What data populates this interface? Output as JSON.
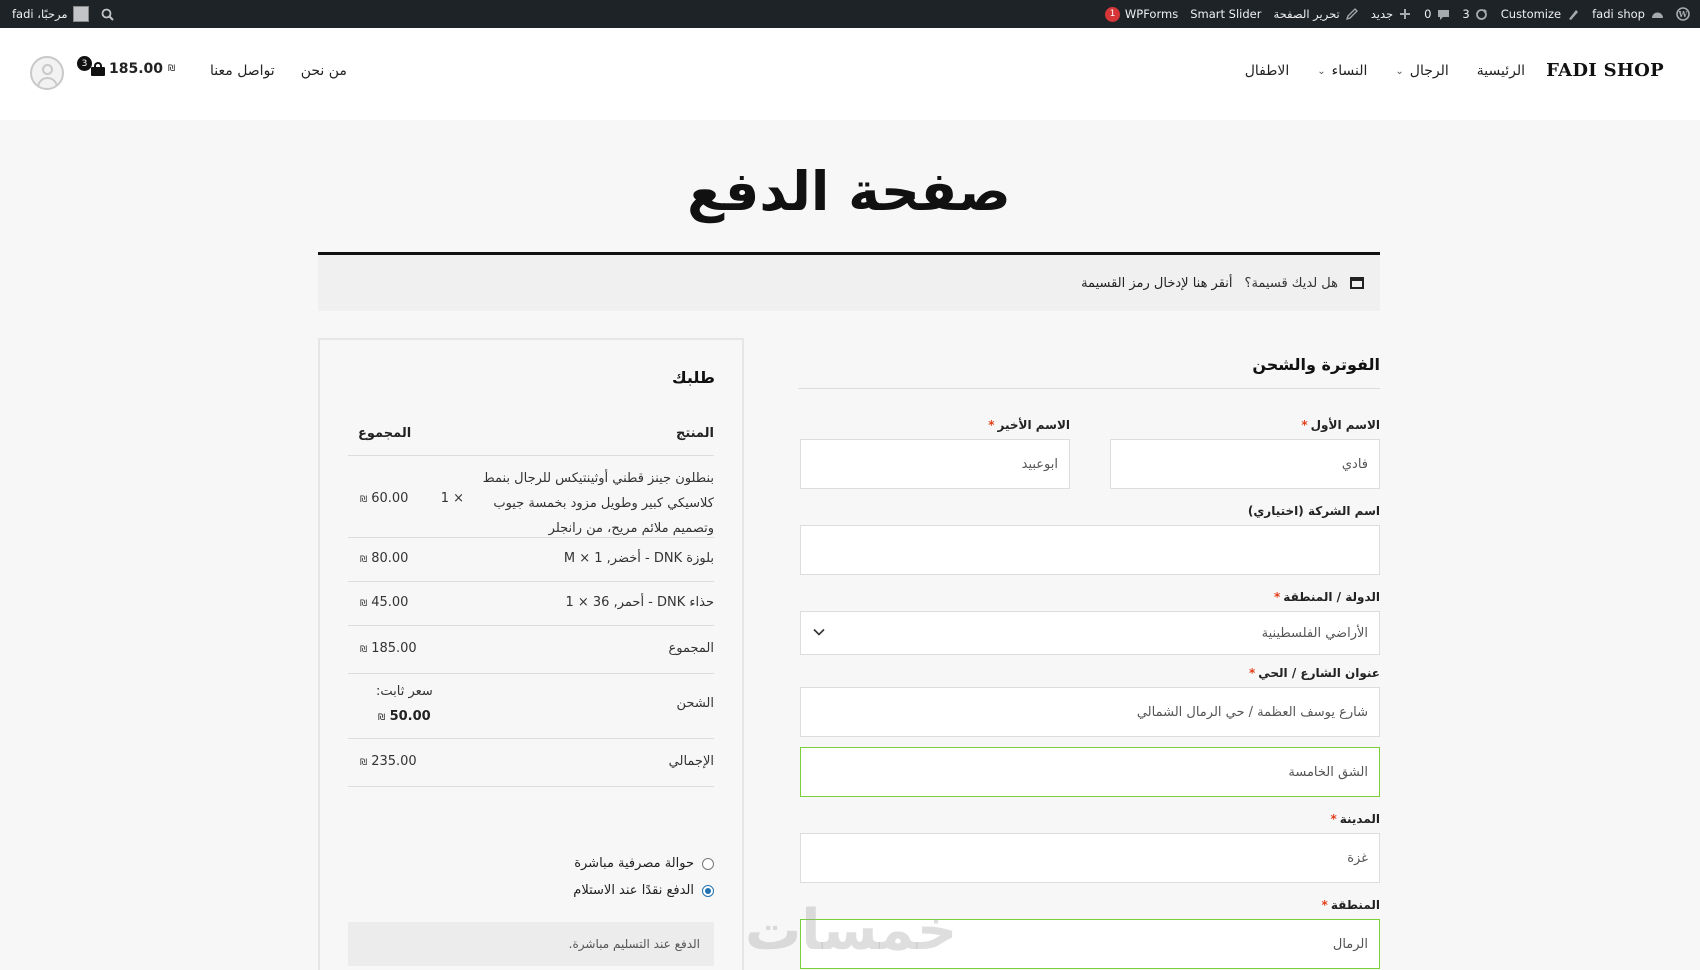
{
  "admin_bar": {
    "right_items": [
      {
        "icon": "wordpress-icon",
        "label": ""
      },
      {
        "icon": "dashboard-icon",
        "label": "fadi shop"
      },
      {
        "icon": "brush-icon",
        "label": "Customize"
      },
      {
        "icon": "update-icon",
        "label": "3"
      },
      {
        "icon": "comment-icon",
        "label": "0"
      },
      {
        "icon": "plus-icon",
        "label": "جديد"
      },
      {
        "icon": "pencil-icon",
        "label": "تحرير الصفحة"
      },
      {
        "icon": "",
        "label": "Smart Slider"
      },
      {
        "icon": "",
        "label": "WPForms",
        "badge": "1"
      }
    ],
    "greeting": "مرحبًا، fadi"
  },
  "header": {
    "logo": "FADI SHOP",
    "nav": [
      {
        "label": "الرئيسية",
        "has_dropdown": false
      },
      {
        "label": "الرجال",
        "has_dropdown": true
      },
      {
        "label": "النساء",
        "has_dropdown": true
      },
      {
        "label": "الاطفال",
        "has_dropdown": false
      }
    ],
    "secondary_nav": [
      {
        "label": "من نحن"
      },
      {
        "label": "تواصل معنا"
      }
    ],
    "cart_total": "185.00",
    "cart_count": "3",
    "currency": "₪"
  },
  "page": {
    "title": "صفحة الدفع",
    "coupon_text": "هل لديك قسيمة؟",
    "coupon_link": "أنقر هنا لإدخال رمز القسيمة"
  },
  "billing": {
    "heading": "الفوترة والشحن",
    "first_name_label": "الاسم الأول",
    "first_name_value": "فادي",
    "last_name_label": "الاسم الأخير",
    "last_name_value": "ابوعبيد",
    "company_label": "اسم الشركة (اختياري)",
    "company_value": "",
    "country_label": "الدولة / المنطقة",
    "country_value": "الأراضي الفلسطينية",
    "street_label": "عنوان الشارع / الحي",
    "street_value": "شارع يوسف العظمة / حي الرمال الشمالي",
    "street2_value": "الشق الخامسة",
    "city_label": "المدينة",
    "city_value": "غزة",
    "region_label": "المنطقة",
    "region_value": "الرمال",
    "required_mark": "*"
  },
  "order": {
    "heading": "طلبك",
    "col_product": "المنتج",
    "col_total": "المجموع",
    "items": [
      {
        "name_lines": [
          "بنطلون جينز قطني أوثينتيكس للرجال بنمط",
          "كلاسيكي كبير وطويل مزود بخمسة جيوب",
          "وتصميم ملائم مريح، من رانجلر"
        ],
        "qty": "× 1",
        "total": "60.00"
      },
      {
        "name_lines": [
          "بلوزة DNK - أخضر, M"
        ],
        "qty": "× 1",
        "total": "80.00"
      },
      {
        "name_lines": [
          "حذاء DNK - أحمر, 36"
        ],
        "qty": "× 1",
        "total": "45.00"
      }
    ],
    "subtotal_label": "المجموع",
    "subtotal": "185.00",
    "shipping_label": "الشحن",
    "shipping_method": "سعر ثابت:",
    "shipping_cost": "50.00",
    "total_label": "الإجمالي",
    "total": "235.00",
    "currency": "₪",
    "payment_methods": [
      {
        "label": "حوالة مصرفية مباشرة",
        "checked": false
      },
      {
        "label": "الدفع نقدًا عند الاستلام",
        "checked": true
      }
    ],
    "payment_description": "الدفع عند التسليم مباشرة."
  },
  "watermark": "خمسات",
  "colors": {
    "admin_bar": "#1d2327",
    "valid_border": "#7ad03a",
    "required": "#e2401c",
    "radio_checked": "#2271b1"
  }
}
